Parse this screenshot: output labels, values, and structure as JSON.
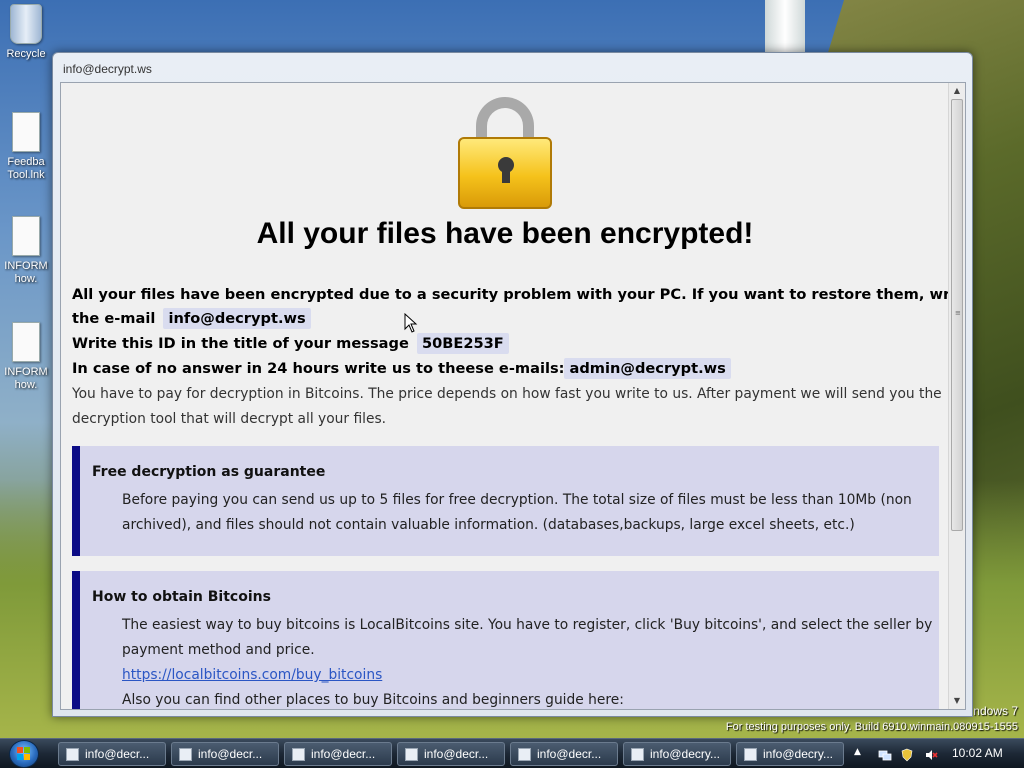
{
  "desktop": {
    "icons": [
      {
        "label": "Recycle"
      },
      {
        "label": "Feedba\nTool.lnk"
      },
      {
        "label": "INFORM\nhow."
      },
      {
        "label": "INFORM\nhow."
      }
    ],
    "watermark": {
      "line1": "ndows 7",
      "line2": "For testing purposes only. Build 6910.winmain.080915-1555"
    }
  },
  "window": {
    "title": "info@decrypt.ws",
    "headline": "All your files have been encrypted!",
    "intro_line1": "All your files have been encrypted due to a security problem with your PC. If you want to restore them, write us to",
    "intro_line2_prefix": "the e-mail",
    "email": "info@decrypt.ws",
    "id_prefix": "Write this ID in the title of your message",
    "id_value": "50BE253F",
    "alt_prefix": "In case of no answer in 24 hours write us to theese e-mails:",
    "alt_email": "admin@decrypt.ws",
    "pay_line1": "You have to pay for decryption in Bitcoins. The price depends on how fast you write to us. After payment we will send you the",
    "pay_line2": "decryption tool that will decrypt all your files.",
    "guarantee": {
      "title": "Free decryption as guarantee",
      "line1": "Before paying you can send us up to 5 files for free decryption. The total size of files must be less than 10Mb (non",
      "line2": "archived), and files should not contain valuable information. (databases,backups, large excel sheets, etc.)"
    },
    "bitcoins": {
      "title": "How to obtain Bitcoins",
      "line1": "The easiest way to buy bitcoins is LocalBitcoins site. You have to register, click 'Buy bitcoins', and select the seller by",
      "line2": "payment method and price.",
      "link": "https://localbitcoins.com/buy_bitcoins",
      "line3": "Also you can find other places to buy Bitcoins and beginners guide here:"
    }
  },
  "taskbar": {
    "buttons": [
      "info@decr...",
      "info@decr...",
      "info@decr...",
      "info@decr...",
      "info@decr...",
      "info@decry...",
      "info@decry..."
    ],
    "clock": "10:02 AM"
  },
  "colors": {
    "accent_bar": "#0c0c86",
    "box_bg": "#d6d6ec",
    "link": "#2b56c4",
    "lock_gold": "#f5c21b"
  }
}
